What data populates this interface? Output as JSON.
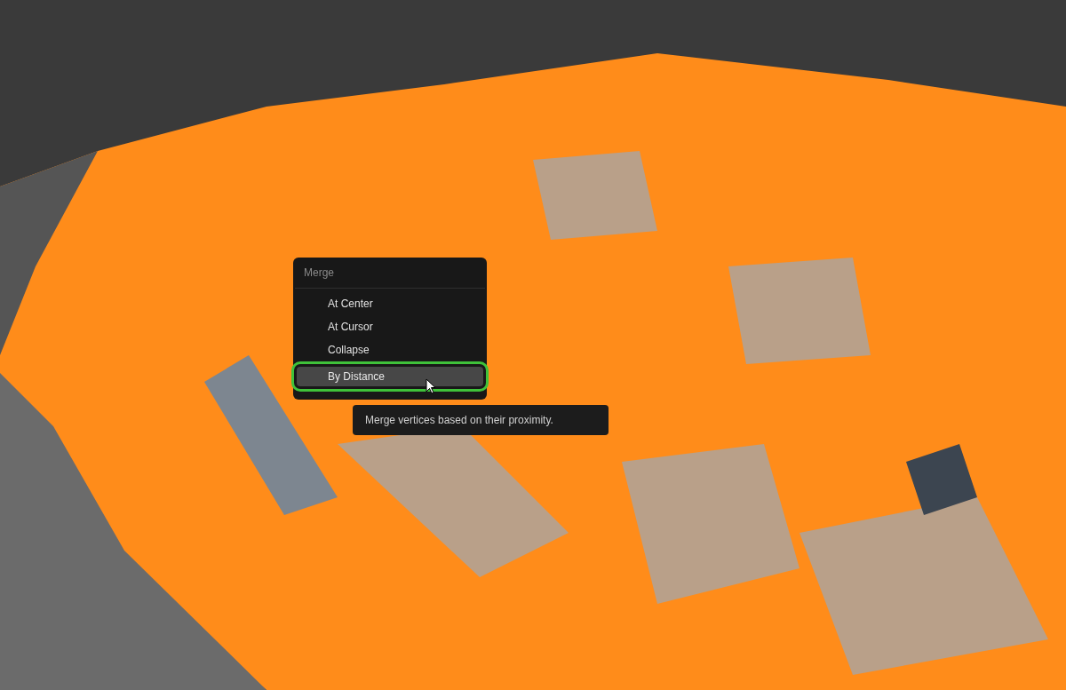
{
  "menu": {
    "title": "Merge",
    "items": [
      {
        "label": "At Center",
        "selected": false
      },
      {
        "label": "At Cursor",
        "selected": false
      },
      {
        "label": "Collapse",
        "selected": false
      },
      {
        "label": "By Distance",
        "selected": true
      }
    ]
  },
  "tooltip": "Merge vertices based on their proximity."
}
